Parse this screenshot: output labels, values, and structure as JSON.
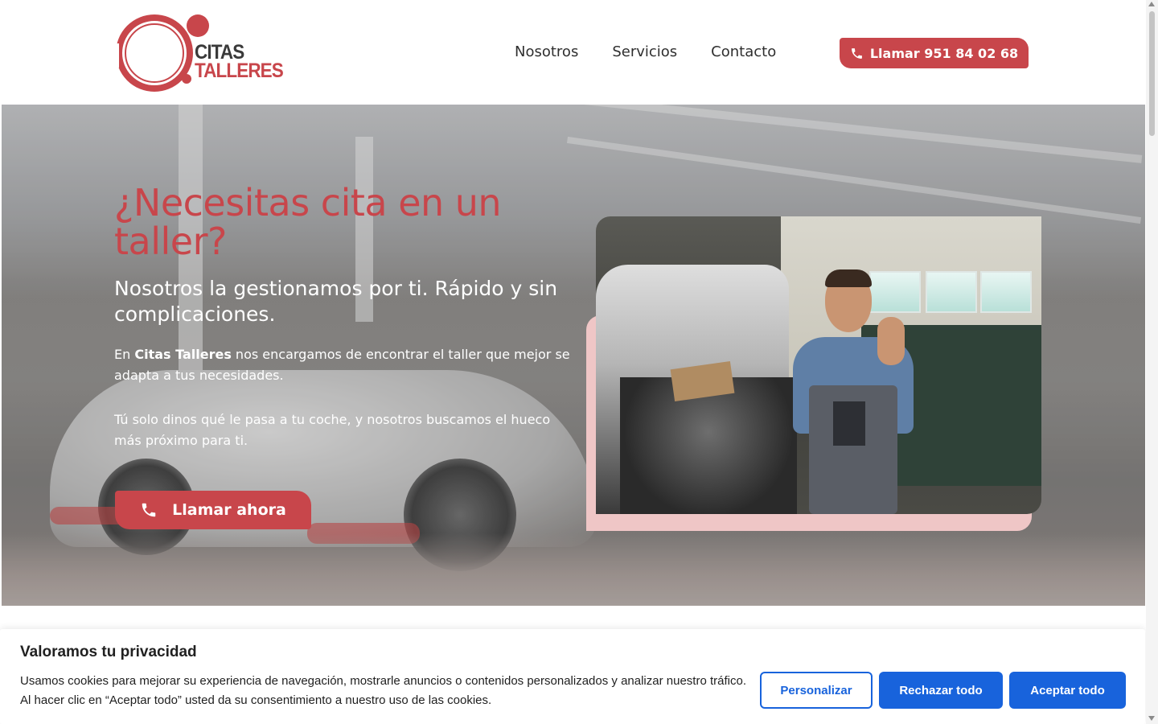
{
  "brand": {
    "line1": "CITAS",
    "line2": "TALLERES",
    "color": "#c8464b"
  },
  "nav": {
    "items": [
      {
        "label": "Nosotros"
      },
      {
        "label": "Servicios"
      },
      {
        "label": "Contacto"
      }
    ],
    "call_label": "Llamar 951 84 02 68",
    "call_icon": "phone-icon"
  },
  "hero": {
    "title": "¿Necesitas cita en un taller?",
    "subtitle": "Nosotros la gestionamos por ti. Rápido y sin complicaciones.",
    "p1_pre": "En ",
    "p1_brand": "Citas Talleres",
    "p1_post": " nos encargamos de encontrar el taller que mejor se adapta a tus necesidades.",
    "p2": "Tú solo dinos qué le pasa a tu coche, y nosotros buscamos el hueco más próximo para ti.",
    "button_label": "Llamar ahora",
    "button_icon": "phone-icon",
    "accent_color": "#c8464b",
    "photo_frame_color": "#efc6c6"
  },
  "cookie": {
    "title": "Valoramos tu privacidad",
    "text": "Usamos cookies para mejorar su experiencia de navegación, mostrarle anuncios o contenidos personalizados y analizar nuestro tráfico. Al hacer clic en “Aceptar todo” usted da su consentimiento a nuestro uso de las cookies.",
    "customize_label": "Personalizar",
    "reject_label": "Rechazar todo",
    "accept_label": "Aceptar todo",
    "button_color": "#1863dc"
  }
}
